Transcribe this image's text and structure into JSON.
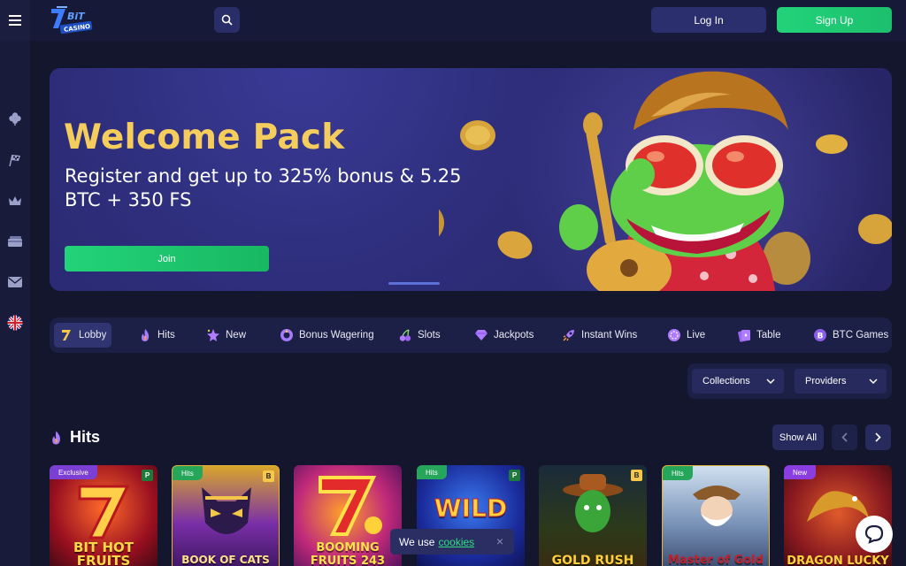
{
  "header": {
    "menu_icon": "hamburger-icon",
    "logo_alt": "7Bit Casino",
    "search_icon": "search-icon",
    "login_label": "Log In",
    "signup_label": "Sign Up"
  },
  "sidebar": {
    "items": [
      {
        "icon": "clover-icon"
      },
      {
        "icon": "racing-flag-icon"
      },
      {
        "icon": "crown-icon"
      },
      {
        "icon": "cards-icon"
      },
      {
        "icon": "mail-icon"
      },
      {
        "icon": "uk-flag-icon"
      }
    ]
  },
  "hero": {
    "title": "Welcome Pack",
    "subtitle": "Register and get up to 325% bonus & 5.25 BTC + 350 FS",
    "join_label": "Join"
  },
  "categories": [
    {
      "label": "Lobby",
      "icon": "seven-logo-icon"
    },
    {
      "label": "Hits",
      "icon": "flame-icon"
    },
    {
      "label": "New",
      "icon": "sparkle-star-icon"
    },
    {
      "label": "Bonus Wagering",
      "icon": "bonus-wheel-icon"
    },
    {
      "label": "Slots",
      "icon": "cherries-icon"
    },
    {
      "label": "Jackpots",
      "icon": "diamond-icon"
    },
    {
      "label": "Instant Wins",
      "icon": "rocket-icon"
    },
    {
      "label": "Live",
      "icon": "live-chip-icon"
    },
    {
      "label": "Table",
      "icon": "table-cards-icon"
    },
    {
      "label": "BTC Games",
      "icon": "bitcoin-icon"
    }
  ],
  "filters": {
    "collections_label": "Collections",
    "providers_label": "Providers"
  },
  "hits": {
    "title": "Hits",
    "show_all_label": "Show All"
  },
  "games": [
    {
      "badge": "Exclusive",
      "corner": "P",
      "name": "BIT HOT FRUITS"
    },
    {
      "badge": "Hits",
      "corner": "B",
      "name": "BOOK OF CATS"
    },
    {
      "badge": "",
      "corner": "",
      "name": "BOOMING FRUITS 243"
    },
    {
      "badge": "Hits",
      "corner": "P",
      "name": "WILD"
    },
    {
      "badge": "",
      "corner": "B",
      "name": "GOLD RUSH"
    },
    {
      "badge": "Hits",
      "corner": "",
      "name": "Master of Gold"
    },
    {
      "badge": "New",
      "corner": "",
      "name": "DRAGON LUCKY"
    }
  ],
  "cookie": {
    "text": "We use",
    "link": "cookies",
    "close": "×"
  },
  "colors": {
    "accent_green": "#22d37a",
    "title_gold": "#f4cd5c",
    "badge_exclusive": "#7b3fd4",
    "badge_hits": "#26a65b",
    "badge_new": "#8a3ee0"
  }
}
